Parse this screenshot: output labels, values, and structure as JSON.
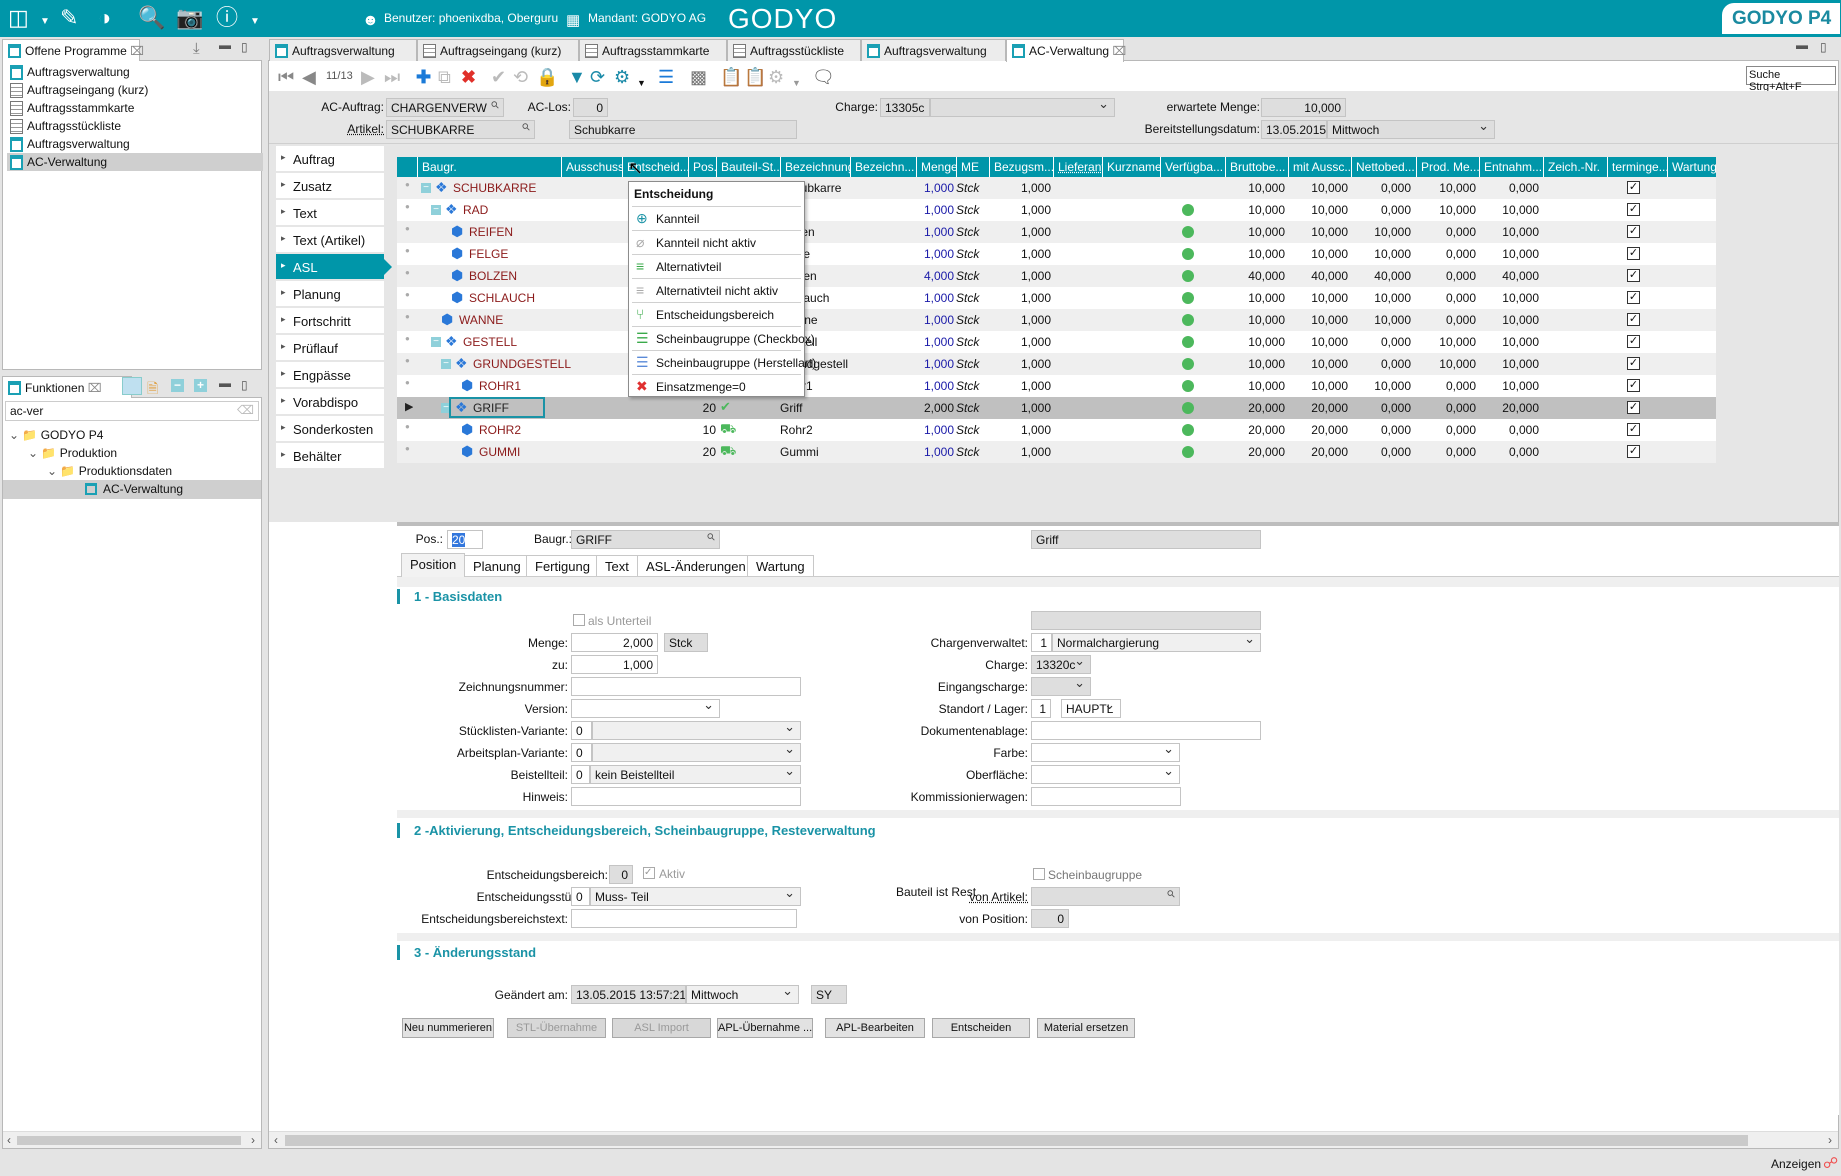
{
  "topbar": {
    "user": "Benutzer: phoenixdba, Oberguru",
    "mandant": "Mandant: GODYO AG",
    "logo_center": "GODYO",
    "logo_right": "GODYO P4",
    "icons": [
      "layout-icon",
      "edit-icon",
      "pie-chart-icon",
      "document-search-icon",
      "camera-icon",
      "help-icon"
    ]
  },
  "left_panel": {
    "open_programs_title": "Offene Programme",
    "open_programs": [
      "Auftragsverwaltung",
      "Auftragseingang (kurz)",
      "Auftragsstammkarte",
      "Auftragsstückliste",
      "Auftragsverwaltung",
      "AC-Verwaltung"
    ],
    "functions_title": "Funktionen",
    "search_value": "ac-ver",
    "tree": [
      {
        "label": "GODYO P4",
        "level": 0,
        "type": "folder"
      },
      {
        "label": "Produktion",
        "level": 1,
        "type": "folder"
      },
      {
        "label": "Produktionsdaten",
        "level": 2,
        "type": "folder"
      },
      {
        "label": "AC-Verwaltung",
        "level": 3,
        "type": "program",
        "selected": true
      }
    ]
  },
  "editor_tabs": [
    "Auftragsverwaltung",
    "Auftragseingang (kurz)",
    "Auftragsstammkarte",
    "Auftragsstückliste",
    "Auftragsverwaltung",
    "AC-Verwaltung"
  ],
  "toolbar": {
    "record_counter": "11/13",
    "search_placeholder": "Suche Strg+Alt+F"
  },
  "header_form": {
    "ac_auftrag_label": "AC-Auftrag:",
    "ac_auftrag": "CHARGENVERW",
    "ac_los_label": "AC-Los:",
    "ac_los": "0",
    "artikel_label": "Artikel:",
    "artikel": "SCHUBKARRE",
    "artikel_desc": "Schubkarre",
    "charge_label": "Charge:",
    "charge": "13305c",
    "charge_select": "",
    "erwartete_menge_label": "erwartete Menge:",
    "erwartete_menge": "10,000",
    "bereitstellung_label": "Bereitstellungsdatum:",
    "bereitstellung_date": "13.05.2015",
    "bereitstellung_day": "Mittwoch"
  },
  "nav": {
    "items": [
      "Auftrag",
      "Zusatz",
      "Text",
      "Text (Artikel)",
      "ASL",
      "Planung",
      "Fortschritt",
      "Prüflauf",
      "Engpässe",
      "Vorabdispo",
      "Sonderkosten",
      "Behälter"
    ],
    "active": "ASL"
  },
  "grid": {
    "columns": [
      "Baugr.",
      "Ausschuss",
      "Entscheid...",
      "Pos.",
      "Bauteil-St...",
      "Bezeichnung",
      "Bezeichn...",
      "Menge",
      "ME",
      "Bezugsm...",
      "Lieferant",
      "Kurzname",
      "Verfügba...",
      "Bruttobe...",
      "mit Aussc...",
      "Nettobed...",
      "Prod. Me...",
      "Entnahm...",
      "Zeich.-Nr.",
      "terminge...",
      "Wartung"
    ],
    "rows": [
      {
        "level": 0,
        "kind": "assembly",
        "expander": true,
        "baugr": "SCHUBKARRE",
        "pos": "",
        "status": "",
        "bez": "Schubkarre",
        "menge": "1,000",
        "me": "Stck",
        "bezugsm": "1,000",
        "avail": false,
        "brutto": "10,000",
        "mitaus": "10,000",
        "netto": "0,000",
        "prod": "10,000",
        "entnahme": "0,000",
        "termin": true
      },
      {
        "level": 1,
        "kind": "assembly",
        "expander": true,
        "baugr": "RAD",
        "pos": "",
        "status": "",
        "bez": "",
        "menge": "1,000",
        "me": "Stck",
        "bezugsm": "1,000",
        "avail": true,
        "brutto": "10,000",
        "mitaus": "10,000",
        "netto": "0,000",
        "prod": "10,000",
        "entnahme": "10,000",
        "termin": true
      },
      {
        "level": 2,
        "kind": "part",
        "expander": false,
        "baugr": "REIFEN",
        "pos": "",
        "status": "",
        "bez": "Reifen",
        "menge": "1,000",
        "me": "Stck",
        "bezugsm": "1,000",
        "avail": true,
        "brutto": "10,000",
        "mitaus": "10,000",
        "netto": "10,000",
        "prod": "0,000",
        "entnahme": "10,000",
        "termin": true
      },
      {
        "level": 2,
        "kind": "part",
        "expander": false,
        "baugr": "FELGE",
        "pos": "",
        "status": "",
        "bez": "Felge",
        "menge": "1,000",
        "me": "Stck",
        "bezugsm": "1,000",
        "avail": true,
        "brutto": "10,000",
        "mitaus": "10,000",
        "netto": "10,000",
        "prod": "0,000",
        "entnahme": "10,000",
        "termin": true
      },
      {
        "level": 2,
        "kind": "part",
        "expander": false,
        "baugr": "BOLZEN",
        "pos": "",
        "status": "",
        "bez": "Bolzen",
        "menge": "4,000",
        "me": "Stck",
        "bezugsm": "1,000",
        "avail": true,
        "brutto": "40,000",
        "mitaus": "40,000",
        "netto": "40,000",
        "prod": "0,000",
        "entnahme": "40,000",
        "termin": true
      },
      {
        "level": 2,
        "kind": "part",
        "expander": false,
        "baugr": "SCHLAUCH",
        "pos": "",
        "status": "",
        "bez": "Schlauch",
        "menge": "1,000",
        "me": "Stck",
        "bezugsm": "1,000",
        "avail": true,
        "brutto": "10,000",
        "mitaus": "10,000",
        "netto": "10,000",
        "prod": "0,000",
        "entnahme": "10,000",
        "termin": true
      },
      {
        "level": 1,
        "kind": "part",
        "expander": false,
        "baugr": "WANNE",
        "pos": "",
        "status": "",
        "bez": "Wanne",
        "menge": "1,000",
        "me": "Stck",
        "bezugsm": "1,000",
        "avail": true,
        "brutto": "10,000",
        "mitaus": "10,000",
        "netto": "10,000",
        "prod": "0,000",
        "entnahme": "10,000",
        "termin": true
      },
      {
        "level": 1,
        "kind": "assembly",
        "expander": true,
        "baugr": "GESTELL",
        "pos": "",
        "status": "",
        "bez": "Gestell",
        "menge": "1,000",
        "me": "Stck",
        "bezugsm": "1,000",
        "avail": true,
        "brutto": "10,000",
        "mitaus": "10,000",
        "netto": "0,000",
        "prod": "10,000",
        "entnahme": "10,000",
        "termin": true
      },
      {
        "level": 2,
        "kind": "assembly",
        "expander": true,
        "baugr": "GRUNDGESTELL",
        "pos": "",
        "status": "",
        "bez": "Grundgestell",
        "menge": "1,000",
        "me": "Stck",
        "bezugsm": "1,000",
        "avail": true,
        "brutto": "10,000",
        "mitaus": "10,000",
        "netto": "0,000",
        "prod": "10,000",
        "entnahme": "10,000",
        "termin": true
      },
      {
        "level": 3,
        "kind": "part",
        "expander": false,
        "baugr": "ROHR1",
        "pos": "",
        "status": "",
        "bez": "Rohr1",
        "menge": "1,000",
        "me": "Stck",
        "bezugsm": "1,000",
        "avail": true,
        "brutto": "10,000",
        "mitaus": "10,000",
        "netto": "10,000",
        "prod": "0,000",
        "entnahme": "10,000",
        "termin": true
      },
      {
        "level": 2,
        "kind": "assembly",
        "expander": true,
        "baugr": "GRIFF",
        "pos": "20",
        "status": "check",
        "bez": "Griff",
        "menge": "2,000",
        "me": "Stck",
        "bezugsm": "1,000",
        "avail": true,
        "brutto": "20,000",
        "mitaus": "20,000",
        "netto": "0,000",
        "prod": "0,000",
        "entnahme": "20,000",
        "termin": true,
        "selected": true
      },
      {
        "level": 3,
        "kind": "part",
        "expander": false,
        "baugr": "ROHR2",
        "pos": "10",
        "status": "truck",
        "bez": "Rohr2",
        "menge": "1,000",
        "me": "Stck",
        "bezugsm": "1,000",
        "avail": true,
        "brutto": "20,000",
        "mitaus": "20,000",
        "netto": "0,000",
        "prod": "0,000",
        "entnahme": "0,000",
        "termin": true
      },
      {
        "level": 3,
        "kind": "part",
        "expander": false,
        "baugr": "GUMMI",
        "pos": "20",
        "status": "truck",
        "bez": "Gummi",
        "menge": "1,000",
        "me": "Stck",
        "bezugsm": "1,000",
        "avail": true,
        "brutto": "20,000",
        "mitaus": "20,000",
        "netto": "0,000",
        "prod": "0,000",
        "entnahme": "0,000",
        "termin": true
      }
    ],
    "colors": {
      "header": "#0096a9",
      "baugr_text": "#8b1a1a",
      "menge_text": "#1a1aa8",
      "available": "#4cb85c",
      "selected_row": "#c0c0c0"
    }
  },
  "context_menu": {
    "title": "Entscheidung",
    "items": [
      {
        "label": "Kannteil",
        "icon": "plus-circle-icon"
      },
      {
        "label": "Kannteil nicht aktiv",
        "icon": "disabled-icon"
      },
      {
        "label": "Alternativteil",
        "icon": "signpost-icon"
      },
      {
        "label": "Alternativteil nicht aktiv",
        "icon": "signpost-disabled-icon"
      },
      {
        "label": "Entscheidungsbereich",
        "icon": "branch-icon"
      },
      {
        "label": "Scheinbaugruppe (Checkbox)",
        "icon": "tree-green-icon"
      },
      {
        "label": "Scheinbaugruppe (Herstellart)",
        "icon": "tree-blue-icon"
      },
      {
        "label": "Einsatzmenge=0",
        "icon": "red-x-icon"
      }
    ]
  },
  "detail": {
    "pos_label": "Pos.:",
    "pos": "20",
    "baugr_label": "Baugr.:",
    "baugr": "GRIFF",
    "baugr_desc": "Griff",
    "tabs": [
      "Position",
      "Planung",
      "Fertigung",
      "Text",
      "ASL-Änderungen",
      "Wartung"
    ],
    "active_tab": "Position",
    "sec1": {
      "title": "1 - Basisdaten",
      "als_unterteil": "als Unterteil",
      "menge_label": "Menge:",
      "menge": "2,000",
      "menge_unit": "Stck",
      "zu_label": "zu:",
      "zu": "1,000",
      "zeichnung_label": "Zeichnungsnummer:",
      "zeichnung": "",
      "version_label": "Version:",
      "version": "",
      "stl_var_label": "Stücklisten-Variante:",
      "stl_var_num": "0",
      "stl_var": "",
      "apl_var_label": "Arbeitsplan-Variante:",
      "apl_var_num": "0",
      "apl_var": "",
      "beistell_label": "Beistellteil:",
      "beistell_num": "0",
      "beistell": "kein Beistellteil",
      "hinweis_label": "Hinweis:",
      "hinweis": "",
      "chargen_label": "Chargenverwaltet:",
      "chargen_num": "1",
      "chargen": "Normalchargierung",
      "charge_label": "Charge:",
      "charge": "13320c",
      "eingang_label": "Eingangscharge:",
      "eingang": "",
      "standort_label": "Standort / Lager:",
      "standort_num": "1",
      "lager": "HAUPTL",
      "dok_label": "Dokumentenablage:",
      "dok": "",
      "farbe_label": "Farbe:",
      "farbe": "",
      "oberflaeche_label": "Oberfläche:",
      "oberflaeche": "",
      "kommission_label": "Kommissionierwagen:",
      "kommission": ""
    },
    "sec2": {
      "title": "2 -Aktivierung, Entscheidungsbereich, Scheinbaugruppe, Resteverwaltung",
      "eb_label": "Entscheidungsbereich:",
      "eb": "0",
      "aktiv": "Aktiv",
      "esl_label": "Entscheidungsstückliste:",
      "esl_num": "0",
      "esl": "Muss- Teil",
      "ebt_label": "Entscheidungsbereichstext:",
      "ebt": "",
      "schein": "Scheinbaugruppe",
      "rest_label": "Bauteil ist Rest",
      "von_artikel_label": "von Artikel:",
      "von_artikel": "",
      "von_pos_label": "von Position:",
      "von_pos": "0"
    },
    "sec3": {
      "title": "3 - Änderungsstand",
      "geaendert_label": "Geändert am:",
      "geaendert": "13.05.2015 13:57:21",
      "day": "Mittwoch",
      "user": "SY"
    },
    "buttons": [
      {
        "label": "Neu nummerieren",
        "enabled": true
      },
      {
        "label": "STL-Übernahme",
        "enabled": false
      },
      {
        "label": "ASL Import",
        "enabled": false
      },
      {
        "label": "APL-Übernahme ...",
        "enabled": true
      },
      {
        "label": "APL-Bearbeiten",
        "enabled": true
      },
      {
        "label": "Entscheiden",
        "enabled": true
      },
      {
        "label": "Material ersetzen",
        "enabled": true
      }
    ]
  },
  "statusbar": {
    "label": "Anzeigen"
  }
}
